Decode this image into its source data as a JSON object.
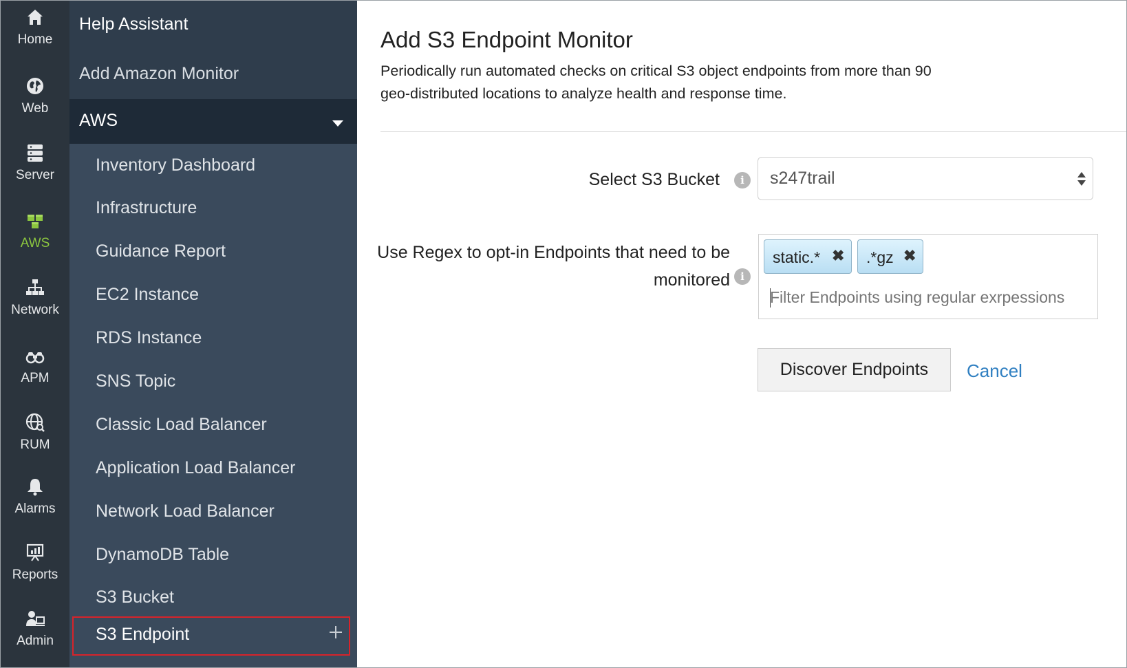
{
  "rail": {
    "items": [
      {
        "label": "Home",
        "icon": "home-icon"
      },
      {
        "label": "Web",
        "icon": "globe-icon"
      },
      {
        "label": "Server",
        "icon": "server-icon"
      },
      {
        "label": "AWS",
        "icon": "aws-cubes-icon",
        "active": true
      },
      {
        "label": "Network",
        "icon": "network-icon"
      },
      {
        "label": "APM",
        "icon": "binoculars-icon"
      },
      {
        "label": "RUM",
        "icon": "globe-search-icon"
      },
      {
        "label": "Alarms",
        "icon": "bell-icon"
      },
      {
        "label": "Reports",
        "icon": "presentation-chart-icon"
      },
      {
        "label": "Admin",
        "icon": "admin-user-icon"
      }
    ],
    "active_color": "#8cc63f"
  },
  "nav": {
    "help_assistant": "Help Assistant",
    "add_amazon_monitor": "Add Amazon Monitor",
    "section": "AWS",
    "items": [
      "Inventory Dashboard",
      "Infrastructure",
      "Guidance Report",
      "EC2 Instance",
      "RDS Instance",
      "SNS Topic",
      "Classic Load Balancer",
      "Application Load Balancer",
      "Network Load Balancer",
      "DynamoDB Table",
      "S3 Bucket"
    ],
    "selected_item": "S3 Endpoint",
    "highlight_color": "#d8232a"
  },
  "main": {
    "title": "Add S3 Endpoint Monitor",
    "description": "Periodically run automated checks on critical S3 object endpoints from more than 90 geo-distributed locations to analyze health and response time.",
    "bucket_label": "Select S3 Bucket",
    "bucket_value": "s247trail",
    "regex_label_line1": "Use Regex to opt-in Endpoints that need to be",
    "regex_label_line2": "monitored",
    "tags": [
      "static.*",
      ".*gz"
    ],
    "filter_placeholder": "Filter Endpoints using regular exrpessions",
    "discover_button": "Discover Endpoints",
    "cancel_link": "Cancel",
    "link_color": "#2f7fc1"
  }
}
